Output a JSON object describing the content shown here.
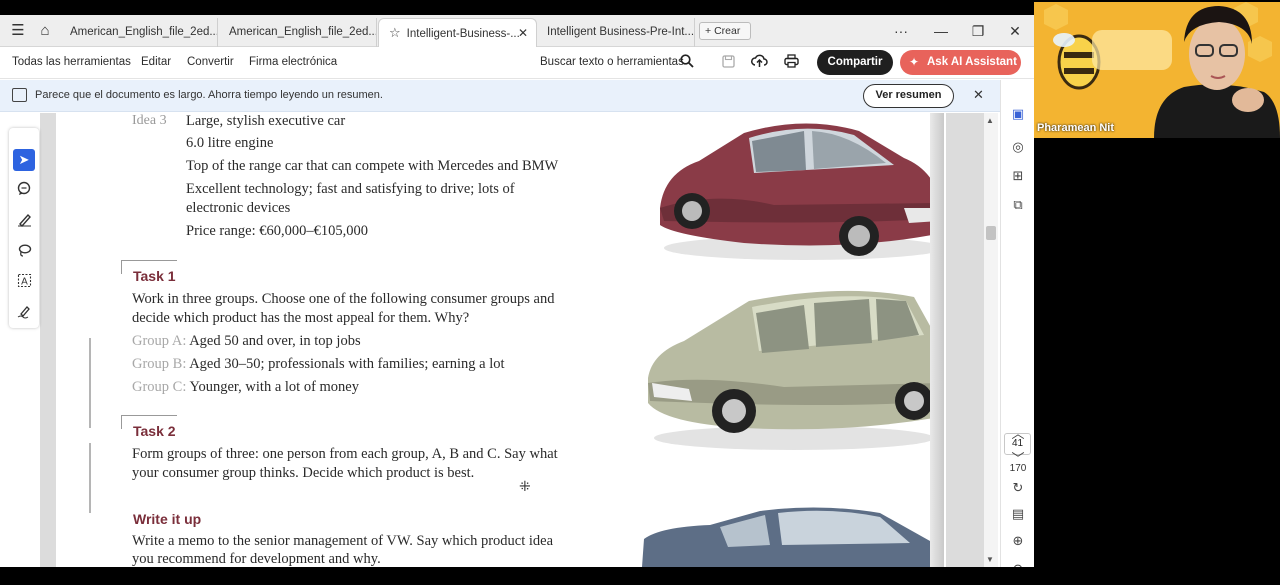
{
  "tabs": [
    {
      "label": "American_English_file_2ed...",
      "active": false
    },
    {
      "label": "American_English_file_2ed...",
      "active": false
    },
    {
      "label": "Intelligent-Business-...",
      "active": true
    },
    {
      "label": "Intelligent Business-Pre-Int...",
      "active": false
    }
  ],
  "new_tab_label": "Crear",
  "window_controls": {
    "more": "···",
    "minimize": "—",
    "restore": "❐",
    "close": "✕"
  },
  "menu": [
    "Todas las herramientas",
    "Editar",
    "Convertir",
    "Firma electrónica"
  ],
  "search_label": "Buscar texto o herramientas",
  "share_label": "Compartir",
  "ai_label": "Ask AI Assistant",
  "banner": {
    "message": "Parece que el documento es largo. Ahorra tiempo leyendo un resumen.",
    "button": "Ver resumen"
  },
  "page_nav": {
    "current": "41",
    "total": "170"
  },
  "document": {
    "idea3_label": "Idea 3",
    "idea3_lines": [
      "Large, stylish executive car",
      "6.0 litre engine",
      "Top of the range car that can compete with Mercedes and BMW",
      "Excellent technology; fast and satisfying to drive; lots of",
      "electronic devices",
      "Price range: €60,000–€105,000"
    ],
    "task1_title": "Task 1",
    "task1_lines": [
      "Work in three groups. Choose one of the following consumer groups and",
      "decide which product has the most appeal for them. Why?"
    ],
    "groups": [
      {
        "label": "Group A:",
        "text": "Aged 50 and over, in top jobs"
      },
      {
        "label": "Group B:",
        "text": "Aged 30–50; professionals with families; earning a lot"
      },
      {
        "label": "Group C:",
        "text": "Younger, with a lot of money"
      }
    ],
    "task2_title": "Task 2",
    "task2_lines": [
      "Form groups of three: one person from each group, A, B and C. Say what",
      "your consumer group thinks. Decide which product is best."
    ],
    "writeup_title": "Write it up",
    "writeup_lines": [
      "Write a memo to the senior management of VW. Say which product idea",
      "you recommend for development and why."
    ]
  },
  "participant_name": "Pharamean Nit",
  "colors": {
    "share_bg": "#1f1f1f",
    "ai_bg": "#e8635b",
    "task_heading": "#7a2e3a",
    "select_tool": "#2d63e0",
    "banner_bg": "#e9f1fb"
  }
}
